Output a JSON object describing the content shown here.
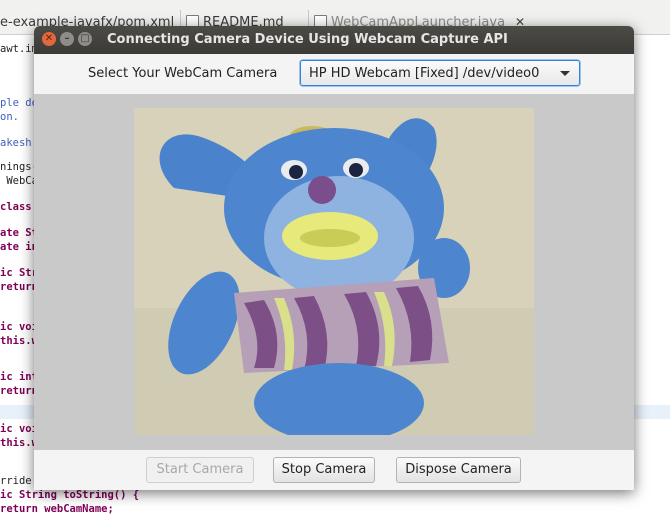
{
  "ide": {
    "tabs": [
      {
        "label": "e-example-javafx/pom.xml"
      },
      {
        "label": "README.md"
      },
      {
        "label": "WebCamAppLauncher.java",
        "close": "✕"
      }
    ],
    "code_lines": [
      {
        "text": "awt.ima",
        "type": "plain"
      },
      {
        "text": "ple den",
        "type": "comment"
      },
      {
        "text": "on.",
        "type": "comment"
      },
      {
        "text": "akesh P",
        "type": "comment"
      },
      {
        "text": "nings(",
        "type": "plain"
      },
      {
        "text": " WebCam",
        "type": "plain"
      },
      {
        "text": "class W",
        "type": "keyword"
      },
      {
        "text": "ate St",
        "type": "keyword"
      },
      {
        "text": "ate int",
        "type": "keyword"
      },
      {
        "text": "ic Stri",
        "type": "keyword"
      },
      {
        "text": "return ",
        "type": "keyword"
      },
      {
        "text": "ic void",
        "type": "keyword"
      },
      {
        "text": "this.web",
        "type": "keyword"
      },
      {
        "text": "ic int ",
        "type": "keyword"
      },
      {
        "text": "return ",
        "type": "keyword"
      },
      {
        "text": "ic void",
        "type": "keyword"
      },
      {
        "text": "this.web",
        "type": "keyword"
      },
      {
        "text": "rride",
        "type": "plain"
      },
      {
        "text": "ic String toString() {",
        "type": "keyword"
      },
      {
        "text": "return webCamName;",
        "type": "keyword"
      }
    ]
  },
  "dialog": {
    "title": "Connecting Camera Device Using Webcam Capture API",
    "window_buttons": {
      "close": "✕",
      "minimize": "–",
      "maximize": "□"
    },
    "select_label": "Select Your WebCam Camera",
    "camera_select": {
      "value": "HP HD Webcam [Fixed] /dev/video0"
    },
    "buttons": {
      "start": {
        "label": "Start Camera",
        "enabled": false
      },
      "stop": {
        "label": "Stop Camera",
        "enabled": true
      },
      "dispose": {
        "label": "Dispose Camera",
        "enabled": true
      }
    },
    "colors": {
      "titlebar": "#3f3e3a",
      "accent": "#3a7fd8",
      "close_button": "#e2683c"
    }
  }
}
